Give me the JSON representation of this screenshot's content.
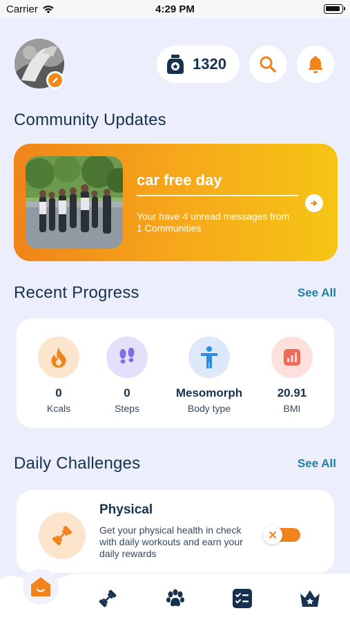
{
  "status_bar": {
    "carrier": "Carrier",
    "time": "4:29 PM"
  },
  "header": {
    "points": "1320"
  },
  "community": {
    "section_title": "Community Updates",
    "card_title": "car free day",
    "message": "Your have 4 unread messages from 1 Communities"
  },
  "progress": {
    "section_title": "Recent Progress",
    "see_all": "See All",
    "stats": [
      {
        "value": "0",
        "label": "Kcals",
        "icon": "flame-icon",
        "color": "#f0841a"
      },
      {
        "value": "0",
        "label": "Steps",
        "icon": "footsteps-icon",
        "color": "#7d6ee8"
      },
      {
        "value": "Mesomorph",
        "label": "Body type",
        "icon": "person-icon",
        "color": "#2a8ee0"
      },
      {
        "value": "20.91",
        "label": "BMI",
        "icon": "chart-icon",
        "color": "#f06a5a"
      }
    ]
  },
  "challenges": {
    "section_title": "Daily Challenges",
    "see_all": "See All",
    "items": [
      {
        "title": "Physical",
        "description": "Get your physical health in check with daily workouts and earn your daily rewards",
        "icon": "dumbbell-icon",
        "toggle_on": true
      }
    ]
  },
  "tab_bar": {
    "items": [
      "home-icon",
      "dumbbell-icon",
      "paw-icon",
      "checklist-icon",
      "crown-icon"
    ],
    "active": "home-icon"
  },
  "colors": {
    "accent": "#f0841a",
    "navy": "#16324f",
    "link": "#1d7fa6",
    "background": "#eceefb"
  }
}
